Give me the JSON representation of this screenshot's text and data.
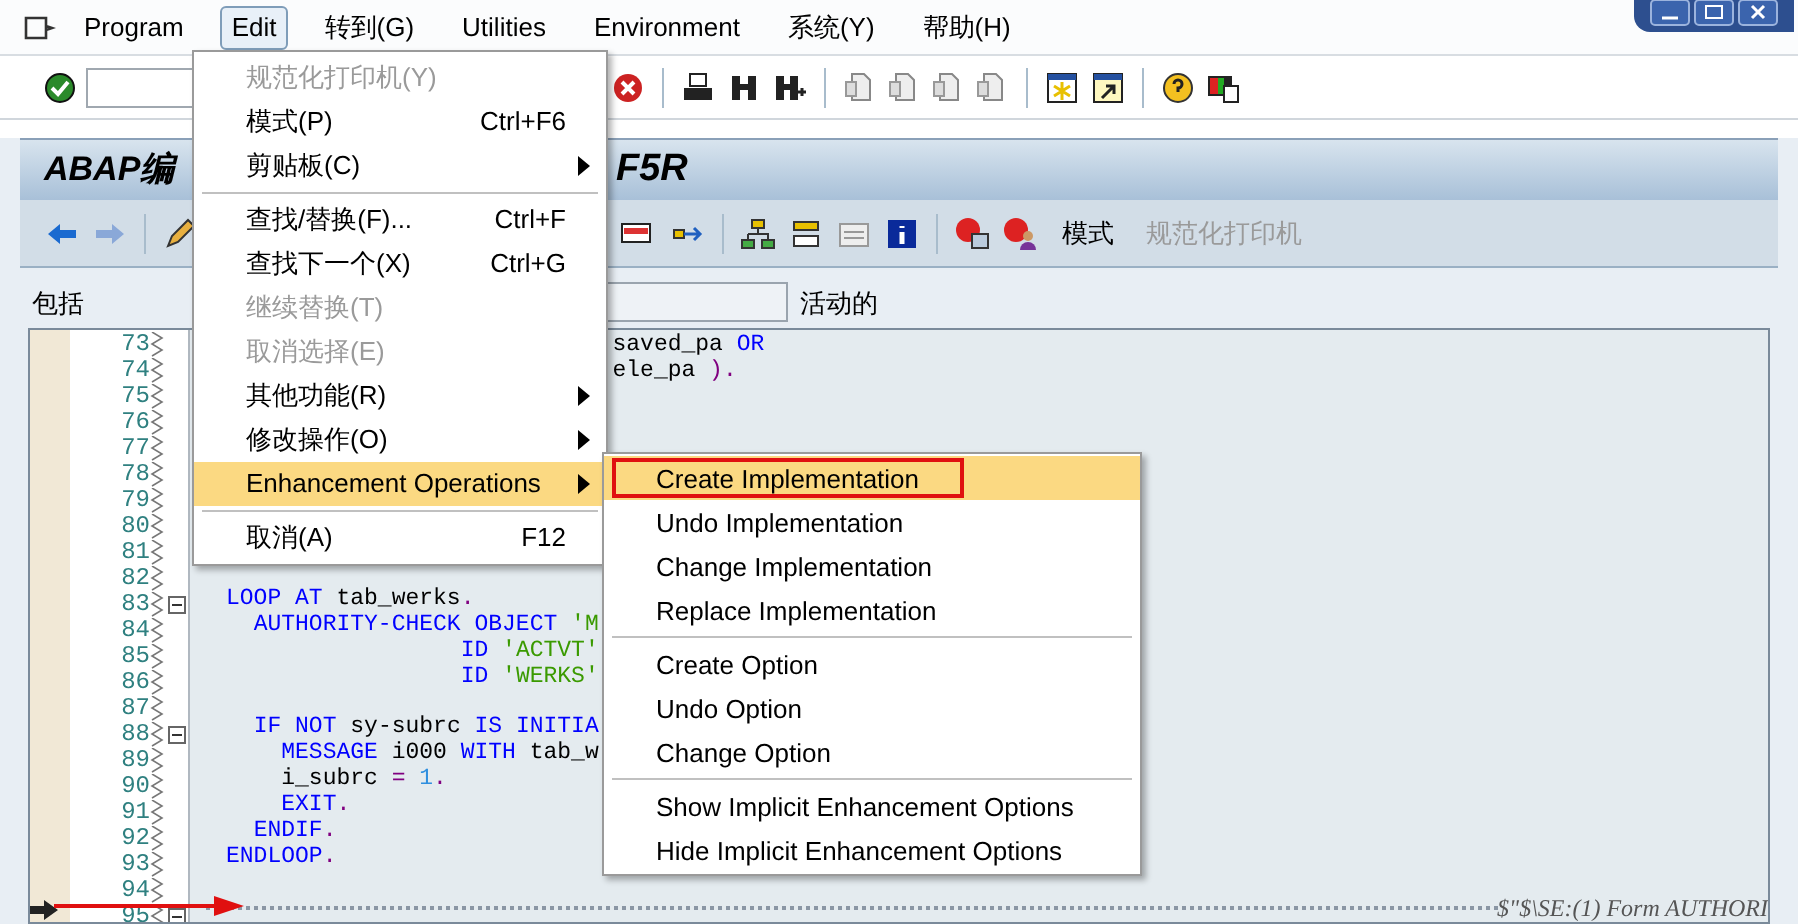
{
  "menu_bar": {
    "items": [
      {
        "label": "Program",
        "selected": false
      },
      {
        "label": "Edit",
        "selected": true
      },
      {
        "label": "转到(G)",
        "selected": false
      },
      {
        "label": "Utilities",
        "selected": false
      },
      {
        "label": "Environment",
        "selected": false
      },
      {
        "label": "系统(Y)",
        "selected": false
      },
      {
        "label": "帮助(H)",
        "selected": false
      }
    ]
  },
  "title": {
    "start": "ABAP编",
    "end": "F5R"
  },
  "app_toolbar": {
    "buttons": [
      {
        "label": "模式",
        "disabled": false
      },
      {
        "label": "规范化打印机",
        "disabled": true
      }
    ]
  },
  "include_row": {
    "label": "包括",
    "status": "活动的"
  },
  "editor": {
    "lines": [
      {
        "number": "73",
        "fold": false,
        "tokens": [
          {
            "text": "                            saved_pa ",
            "kind": "plain"
          },
          {
            "text": "OR",
            "kind": "keyword"
          }
        ]
      },
      {
        "number": "74",
        "fold": false,
        "tokens": [
          {
            "text": "                            ele_pa ",
            "kind": "plain"
          },
          {
            "text": ").",
            "kind": "punct"
          }
        ]
      },
      {
        "number": "75",
        "fold": false
      },
      {
        "number": "76",
        "fold": false
      },
      {
        "number": "77",
        "fold": false
      },
      {
        "number": "78",
        "fold": false
      },
      {
        "number": "79",
        "fold": false
      },
      {
        "number": "80",
        "fold": false
      },
      {
        "number": "81",
        "fold": false
      },
      {
        "number": "82",
        "fold": false
      },
      {
        "number": "83",
        "fold": true,
        "tokens": [
          {
            "text": "LOOP AT",
            "kind": "keyword"
          },
          {
            "text": " tab_werks",
            "kind": "plain"
          },
          {
            "text": ".",
            "kind": "punct"
          }
        ]
      },
      {
        "number": "84",
        "fold": false,
        "tokens": [
          {
            "text": "  AUTHORITY-CHECK OBJECT",
            "kind": "keyword"
          },
          {
            "text": " 'M",
            "kind": "string"
          }
        ]
      },
      {
        "number": "85",
        "fold": false,
        "tokens": [
          {
            "text": "                 ID",
            "kind": "keyword"
          },
          {
            "text": " 'ACTVT'",
            "kind": "string"
          }
        ]
      },
      {
        "number": "86",
        "fold": false,
        "tokens": [
          {
            "text": "                 ID",
            "kind": "keyword"
          },
          {
            "text": " 'WERKS'",
            "kind": "string"
          }
        ]
      },
      {
        "number": "87",
        "fold": false
      },
      {
        "number": "88",
        "fold": true,
        "tokens": [
          {
            "text": "  IF NOT",
            "kind": "keyword"
          },
          {
            "text": " sy-subrc ",
            "kind": "plain"
          },
          {
            "text": "IS INITIA",
            "kind": "keyword"
          }
        ]
      },
      {
        "number": "89",
        "fold": false,
        "tokens": [
          {
            "text": "    MESSAGE",
            "kind": "keyword"
          },
          {
            "text": " i000 ",
            "kind": "plain"
          },
          {
            "text": "WITH",
            "kind": "keyword"
          },
          {
            "text": " tab_w",
            "kind": "plain"
          }
        ]
      },
      {
        "number": "90",
        "fold": false,
        "tokens": [
          {
            "text": "    i_subrc ",
            "kind": "plain"
          },
          {
            "text": "= ",
            "kind": "punct"
          },
          {
            "text": "1",
            "kind": "number"
          },
          {
            "text": ".",
            "kind": "punct"
          }
        ]
      },
      {
        "number": "91",
        "fold": false,
        "tokens": [
          {
            "text": "    EXIT",
            "kind": "keyword"
          },
          {
            "text": ".",
            "kind": "punct"
          }
        ]
      },
      {
        "number": "92",
        "fold": false,
        "tokens": [
          {
            "text": "  ENDIF",
            "kind": "keyword"
          },
          {
            "text": ".",
            "kind": "punct"
          }
        ]
      },
      {
        "number": "93",
        "fold": false,
        "tokens": [
          {
            "text": "ENDLOOP",
            "kind": "keyword"
          },
          {
            "text": ".",
            "kind": "punct"
          }
        ]
      },
      {
        "number": "94",
        "fold": false
      },
      {
        "number": "95",
        "fold": true,
        "current": true,
        "enhancement_marker": "$\"$\\SE:(1) Form AUTHORI"
      }
    ]
  },
  "edit_menu": {
    "items": [
      {
        "kind": "item",
        "label": "规范化打印机(Y)",
        "disabled": true,
        "selected": false
      },
      {
        "kind": "item",
        "label": "模式(P)",
        "shortcut": "Ctrl+F6",
        "disabled": false,
        "selected": false
      },
      {
        "kind": "submenu",
        "label": "剪贴板(C)",
        "disabled": false,
        "selected": false
      },
      {
        "kind": "separator"
      },
      {
        "kind": "item",
        "label": "查找/替换(F)...",
        "shortcut": "Ctrl+F",
        "disabled": false,
        "selected": false
      },
      {
        "kind": "item",
        "label": "查找下一个(X)",
        "shortcut": "Ctrl+G",
        "disabled": false,
        "selected": false
      },
      {
        "kind": "item",
        "label": "继续替换(T)",
        "disabled": true,
        "selected": false
      },
      {
        "kind": "item",
        "label": "取消选择(E)",
        "disabled": true,
        "selected": false
      },
      {
        "kind": "submenu",
        "label": "其他功能(R)",
        "disabled": false,
        "selected": false
      },
      {
        "kind": "submenu",
        "label": "修改操作(O)",
        "disabled": false,
        "selected": false
      },
      {
        "kind": "submenu",
        "label": "Enhancement Operations",
        "disabled": false,
        "selected": true
      },
      {
        "kind": "separator"
      },
      {
        "kind": "item",
        "label": "取消(A)",
        "shortcut": "F12",
        "disabled": false,
        "selected": false
      }
    ]
  },
  "enhancement_submenu": {
    "items": [
      {
        "kind": "item",
        "label": "Create Implementation",
        "selected": true,
        "annotated": true
      },
      {
        "kind": "item",
        "label": "Undo Implementation",
        "selected": false,
        "annotated": false
      },
      {
        "kind": "item",
        "label": "Change Implementation",
        "selected": false,
        "annotated": false
      },
      {
        "kind": "item",
        "label": "Replace Implementation",
        "selected": false,
        "annotated": false
      },
      {
        "kind": "separator"
      },
      {
        "kind": "item",
        "label": "Create Option",
        "selected": false,
        "annotated": false
      },
      {
        "kind": "item",
        "label": "Undo Option",
        "selected": false,
        "annotated": false
      },
      {
        "kind": "item",
        "label": "Change Option",
        "selected": false,
        "annotated": false
      },
      {
        "kind": "separator"
      },
      {
        "kind": "item",
        "label": "Show Implicit Enhancement Options",
        "selected": false,
        "annotated": false
      },
      {
        "kind": "item",
        "label": "Hide Implicit Enhancement Options",
        "selected": false,
        "annotated": false
      }
    ]
  }
}
